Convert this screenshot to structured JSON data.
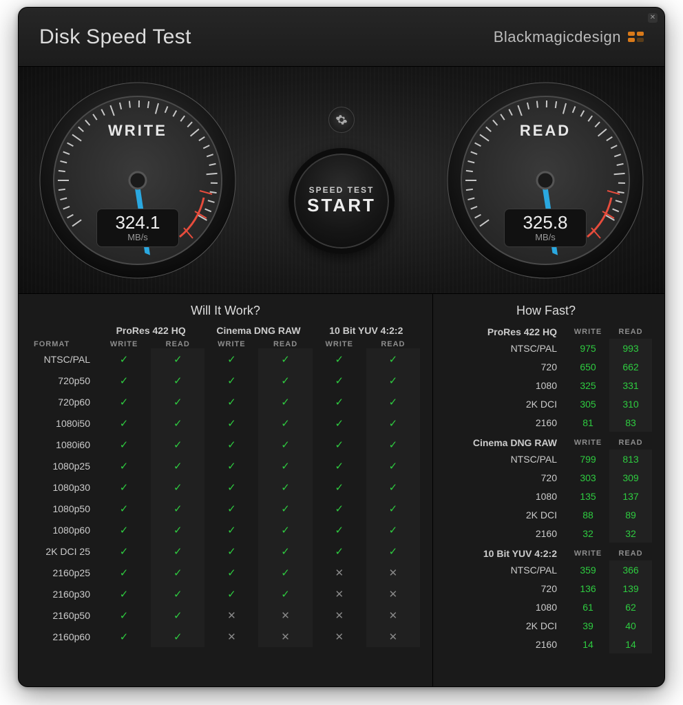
{
  "header": {
    "title": "Disk Speed Test",
    "brand": "Blackmagicdesign"
  },
  "gauges": {
    "write": {
      "label": "WRITE",
      "value": "324.1",
      "unit": "MB/s",
      "needle_angle": -82
    },
    "read": {
      "label": "READ",
      "value": "325.8",
      "unit": "MB/s",
      "needle_angle": -82
    }
  },
  "center": {
    "line1": "SPEED TEST",
    "line2": "START"
  },
  "will_it_work": {
    "title": "Will It Work?",
    "format_header": "FORMAT",
    "sub_write": "WRITE",
    "sub_read": "READ",
    "codecs": [
      "ProRes 422 HQ",
      "Cinema DNG RAW",
      "10 Bit YUV 4:2:2"
    ],
    "rows": [
      {
        "fmt": "NTSC/PAL",
        "v": [
          true,
          true,
          true,
          true,
          true,
          true
        ]
      },
      {
        "fmt": "720p50",
        "v": [
          true,
          true,
          true,
          true,
          true,
          true
        ]
      },
      {
        "fmt": "720p60",
        "v": [
          true,
          true,
          true,
          true,
          true,
          true
        ]
      },
      {
        "fmt": "1080i50",
        "v": [
          true,
          true,
          true,
          true,
          true,
          true
        ]
      },
      {
        "fmt": "1080i60",
        "v": [
          true,
          true,
          true,
          true,
          true,
          true
        ]
      },
      {
        "fmt": "1080p25",
        "v": [
          true,
          true,
          true,
          true,
          true,
          true
        ]
      },
      {
        "fmt": "1080p30",
        "v": [
          true,
          true,
          true,
          true,
          true,
          true
        ]
      },
      {
        "fmt": "1080p50",
        "v": [
          true,
          true,
          true,
          true,
          true,
          true
        ]
      },
      {
        "fmt": "1080p60",
        "v": [
          true,
          true,
          true,
          true,
          true,
          true
        ]
      },
      {
        "fmt": "2K DCI 25",
        "v": [
          true,
          true,
          true,
          true,
          true,
          true
        ]
      },
      {
        "fmt": "2160p25",
        "v": [
          true,
          true,
          true,
          true,
          false,
          false
        ]
      },
      {
        "fmt": "2160p30",
        "v": [
          true,
          true,
          true,
          true,
          false,
          false
        ]
      },
      {
        "fmt": "2160p50",
        "v": [
          true,
          true,
          false,
          false,
          false,
          false
        ]
      },
      {
        "fmt": "2160p60",
        "v": [
          true,
          true,
          false,
          false,
          false,
          false
        ]
      }
    ]
  },
  "how_fast": {
    "title": "How Fast?",
    "sub_write": "WRITE",
    "sub_read": "READ",
    "sections": [
      {
        "codec": "ProRes 422 HQ",
        "rows": [
          {
            "fmt": "NTSC/PAL",
            "w": "975",
            "r": "993"
          },
          {
            "fmt": "720",
            "w": "650",
            "r": "662"
          },
          {
            "fmt": "1080",
            "w": "325",
            "r": "331"
          },
          {
            "fmt": "2K DCI",
            "w": "305",
            "r": "310"
          },
          {
            "fmt": "2160",
            "w": "81",
            "r": "83"
          }
        ]
      },
      {
        "codec": "Cinema DNG RAW",
        "rows": [
          {
            "fmt": "NTSC/PAL",
            "w": "799",
            "r": "813"
          },
          {
            "fmt": "720",
            "w": "303",
            "r": "309"
          },
          {
            "fmt": "1080",
            "w": "135",
            "r": "137"
          },
          {
            "fmt": "2K DCI",
            "w": "88",
            "r": "89"
          },
          {
            "fmt": "2160",
            "w": "32",
            "r": "32"
          }
        ]
      },
      {
        "codec": "10 Bit YUV 4:2:2",
        "rows": [
          {
            "fmt": "NTSC/PAL",
            "w": "359",
            "r": "366"
          },
          {
            "fmt": "720",
            "w": "136",
            "r": "139"
          },
          {
            "fmt": "1080",
            "w": "61",
            "r": "62"
          },
          {
            "fmt": "2K DCI",
            "w": "39",
            "r": "40"
          },
          {
            "fmt": "2160",
            "w": "14",
            "r": "14"
          }
        ]
      }
    ]
  }
}
